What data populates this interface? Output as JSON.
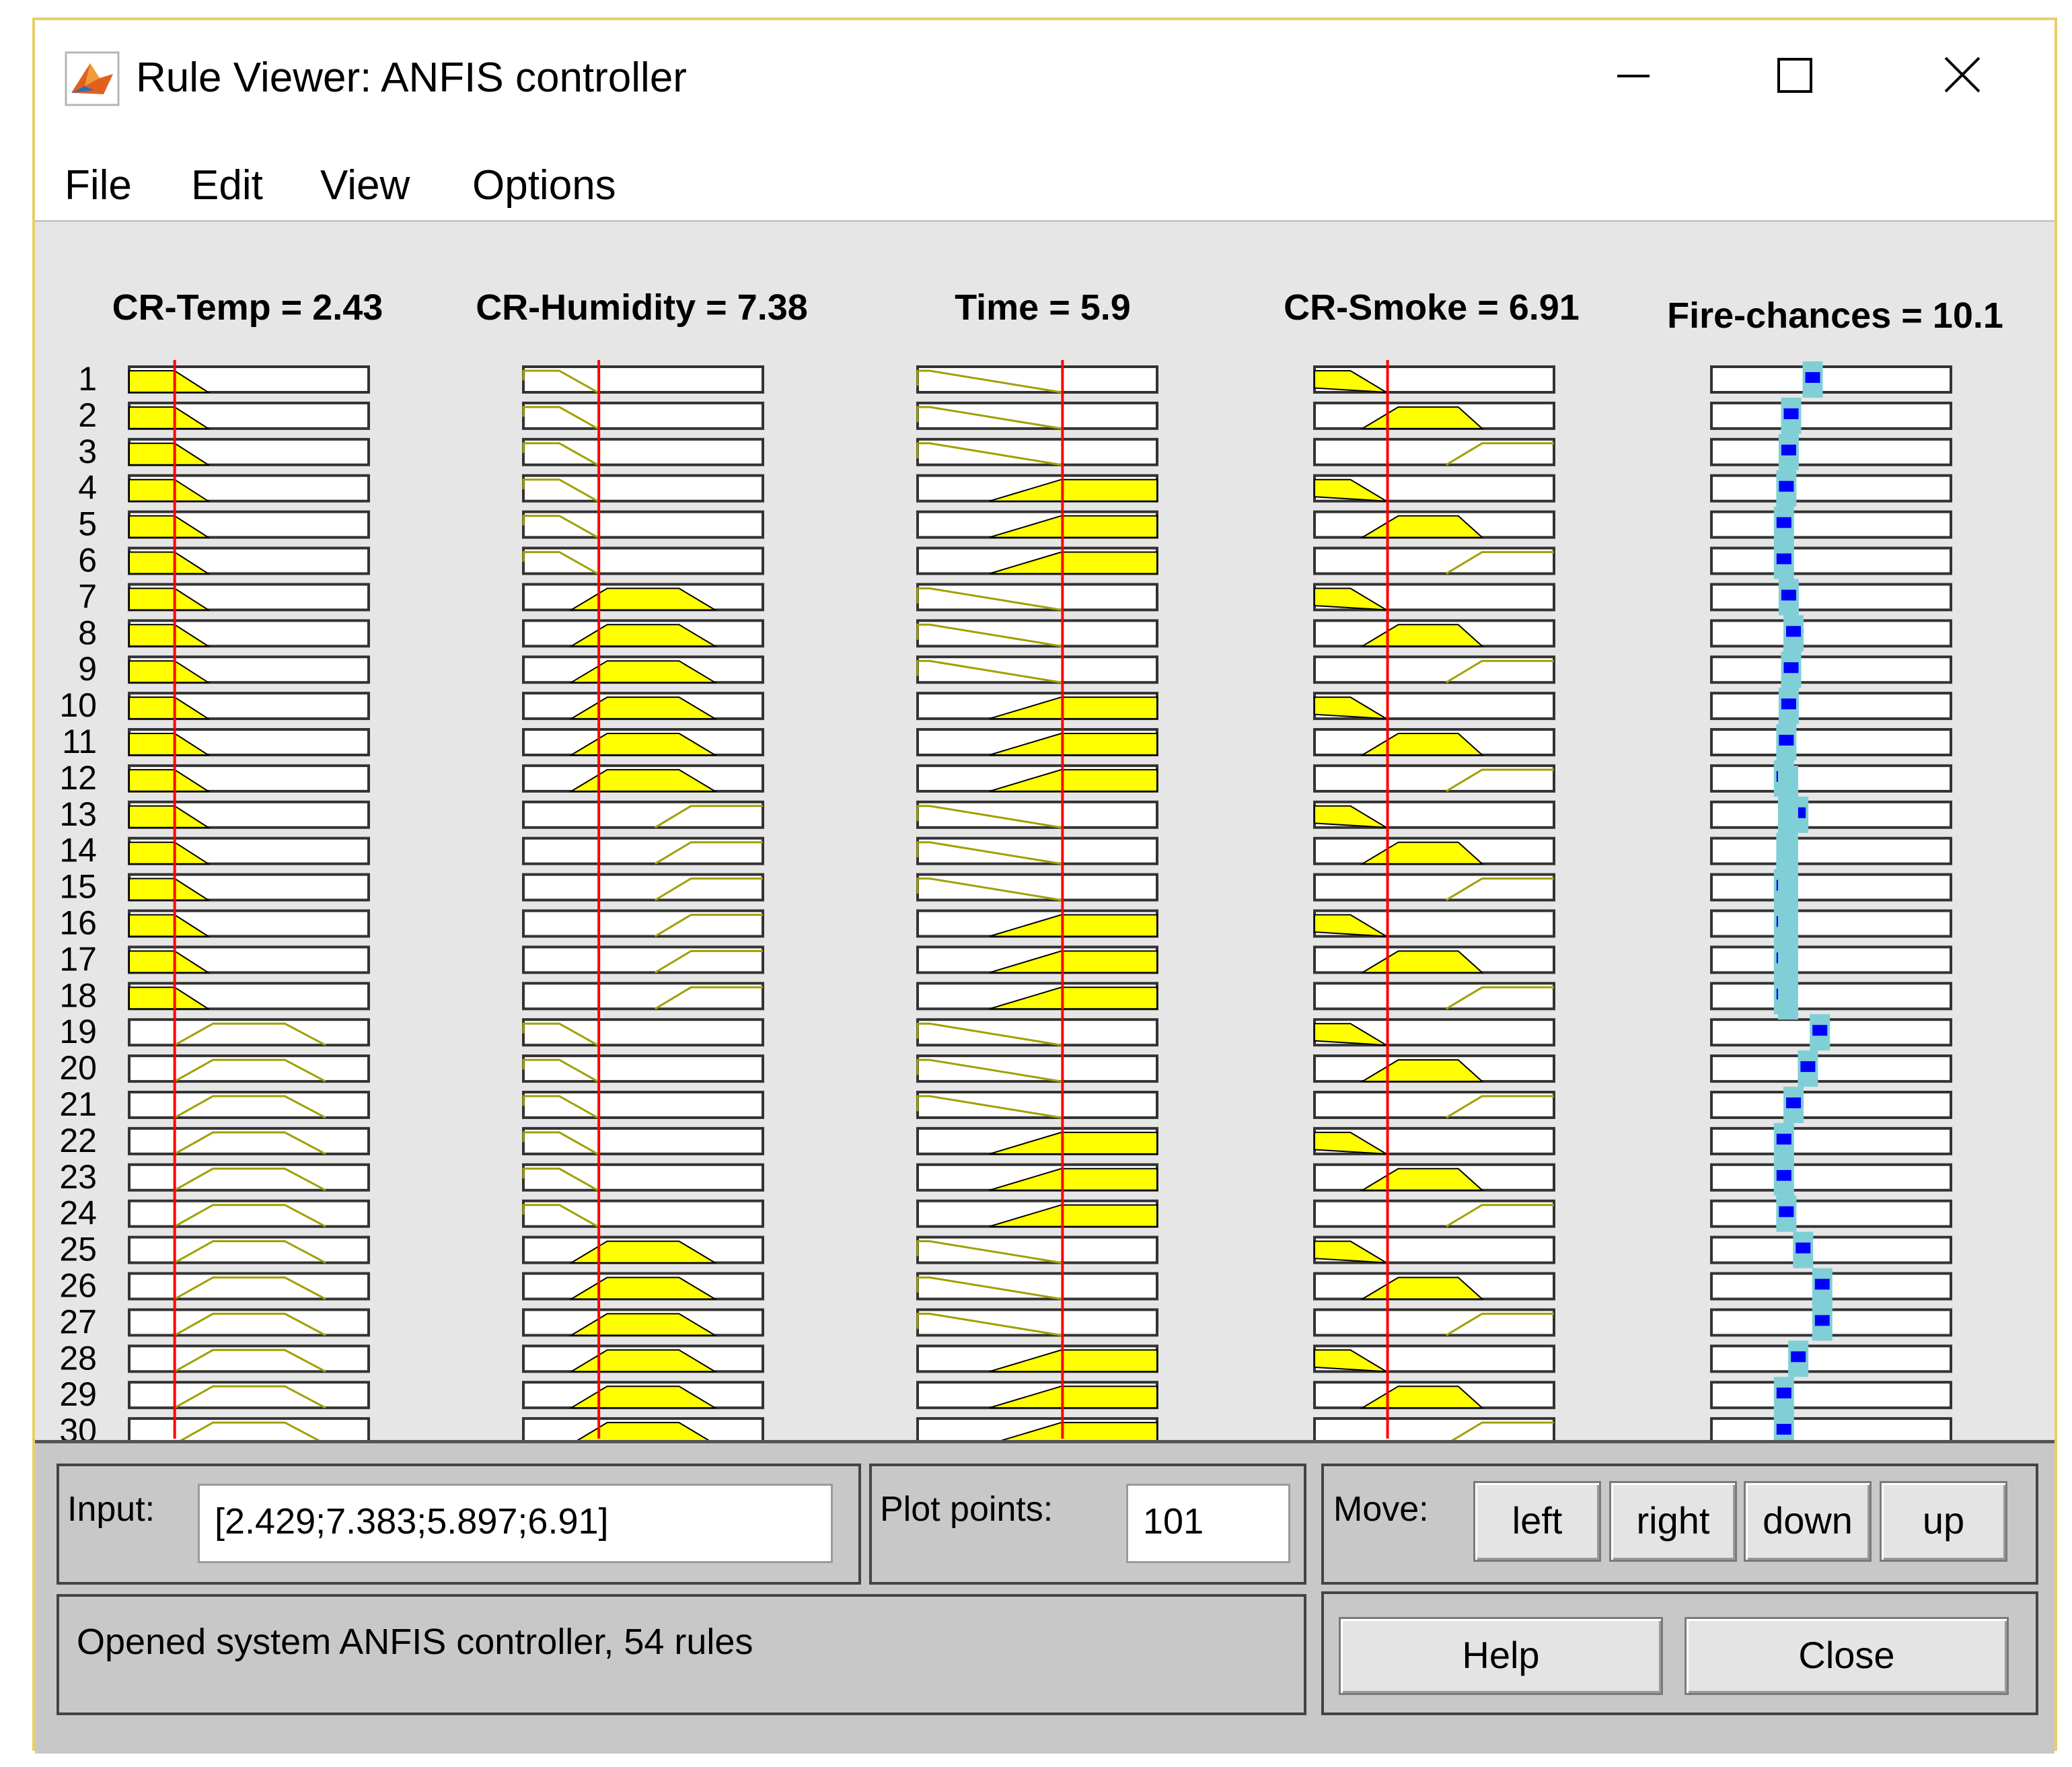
{
  "window": {
    "title": "Rule Viewer: ANFIS controller",
    "controls": {
      "minimize": "minimize-icon",
      "maximize": "maximize-icon",
      "close": "close-icon"
    }
  },
  "menu": [
    {
      "label": "File"
    },
    {
      "label": "Edit"
    },
    {
      "label": "View"
    },
    {
      "label": "Options"
    }
  ],
  "colors": {
    "mf_fill": "#ffff00",
    "mf_line": "#a0a000",
    "input_line": "#ff0000",
    "output_agg": "#80cfd6",
    "output_val": "#0000ff",
    "background": "#e6e6e6",
    "panel": "#c8c8c8"
  },
  "variables": [
    {
      "name": "CR-Temp",
      "title": "CR-Temp = 2.43"
    },
    {
      "name": "CR-Humidity",
      "title": "CR-Humidity = 7.38"
    },
    {
      "name": "Time",
      "title": "Time = 5.9"
    },
    {
      "name": "CR-Smoke",
      "title": "CR-Smoke = 6.91"
    },
    {
      "name": "Fire-chances",
      "title": "Fire-chances = 10.1"
    }
  ],
  "rules": [
    "1",
    "2",
    "3",
    "4",
    "5",
    "6",
    "7",
    "8",
    "9",
    "10",
    "11",
    "12",
    "13",
    "14",
    "15",
    "16",
    "17",
    "18",
    "19",
    "20",
    "21",
    "22",
    "23",
    "24",
    "25",
    "26",
    "27",
    "28",
    "29",
    "30"
  ],
  "input_line_fraction": [
    0.19,
    0.315,
    0.605,
    0.305
  ],
  "output_offsets": [
    0.42,
    0.33,
    0.32,
    0.31,
    0.3,
    0.3,
    0.32,
    0.34,
    0.33,
    0.32,
    0.31,
    0.3,
    0.36,
    0.31,
    0.3,
    0.3,
    0.3,
    0.3,
    0.45,
    0.4,
    0.34,
    0.3,
    0.3,
    0.31,
    0.38,
    0.46,
    0.46,
    0.36,
    0.3,
    0.3
  ],
  "controls": {
    "input_label": "Input:",
    "input_value": "[2.429;7.383;5.897;6.91]",
    "plot_points_label": "Plot points:",
    "plot_points_value": "101",
    "move_label": "Move:",
    "move_buttons": [
      "left",
      "right",
      "down",
      "up"
    ],
    "help_label": "Help",
    "close_label": "Close"
  },
  "status": "Opened system ANFIS controller, 54 rules"
}
